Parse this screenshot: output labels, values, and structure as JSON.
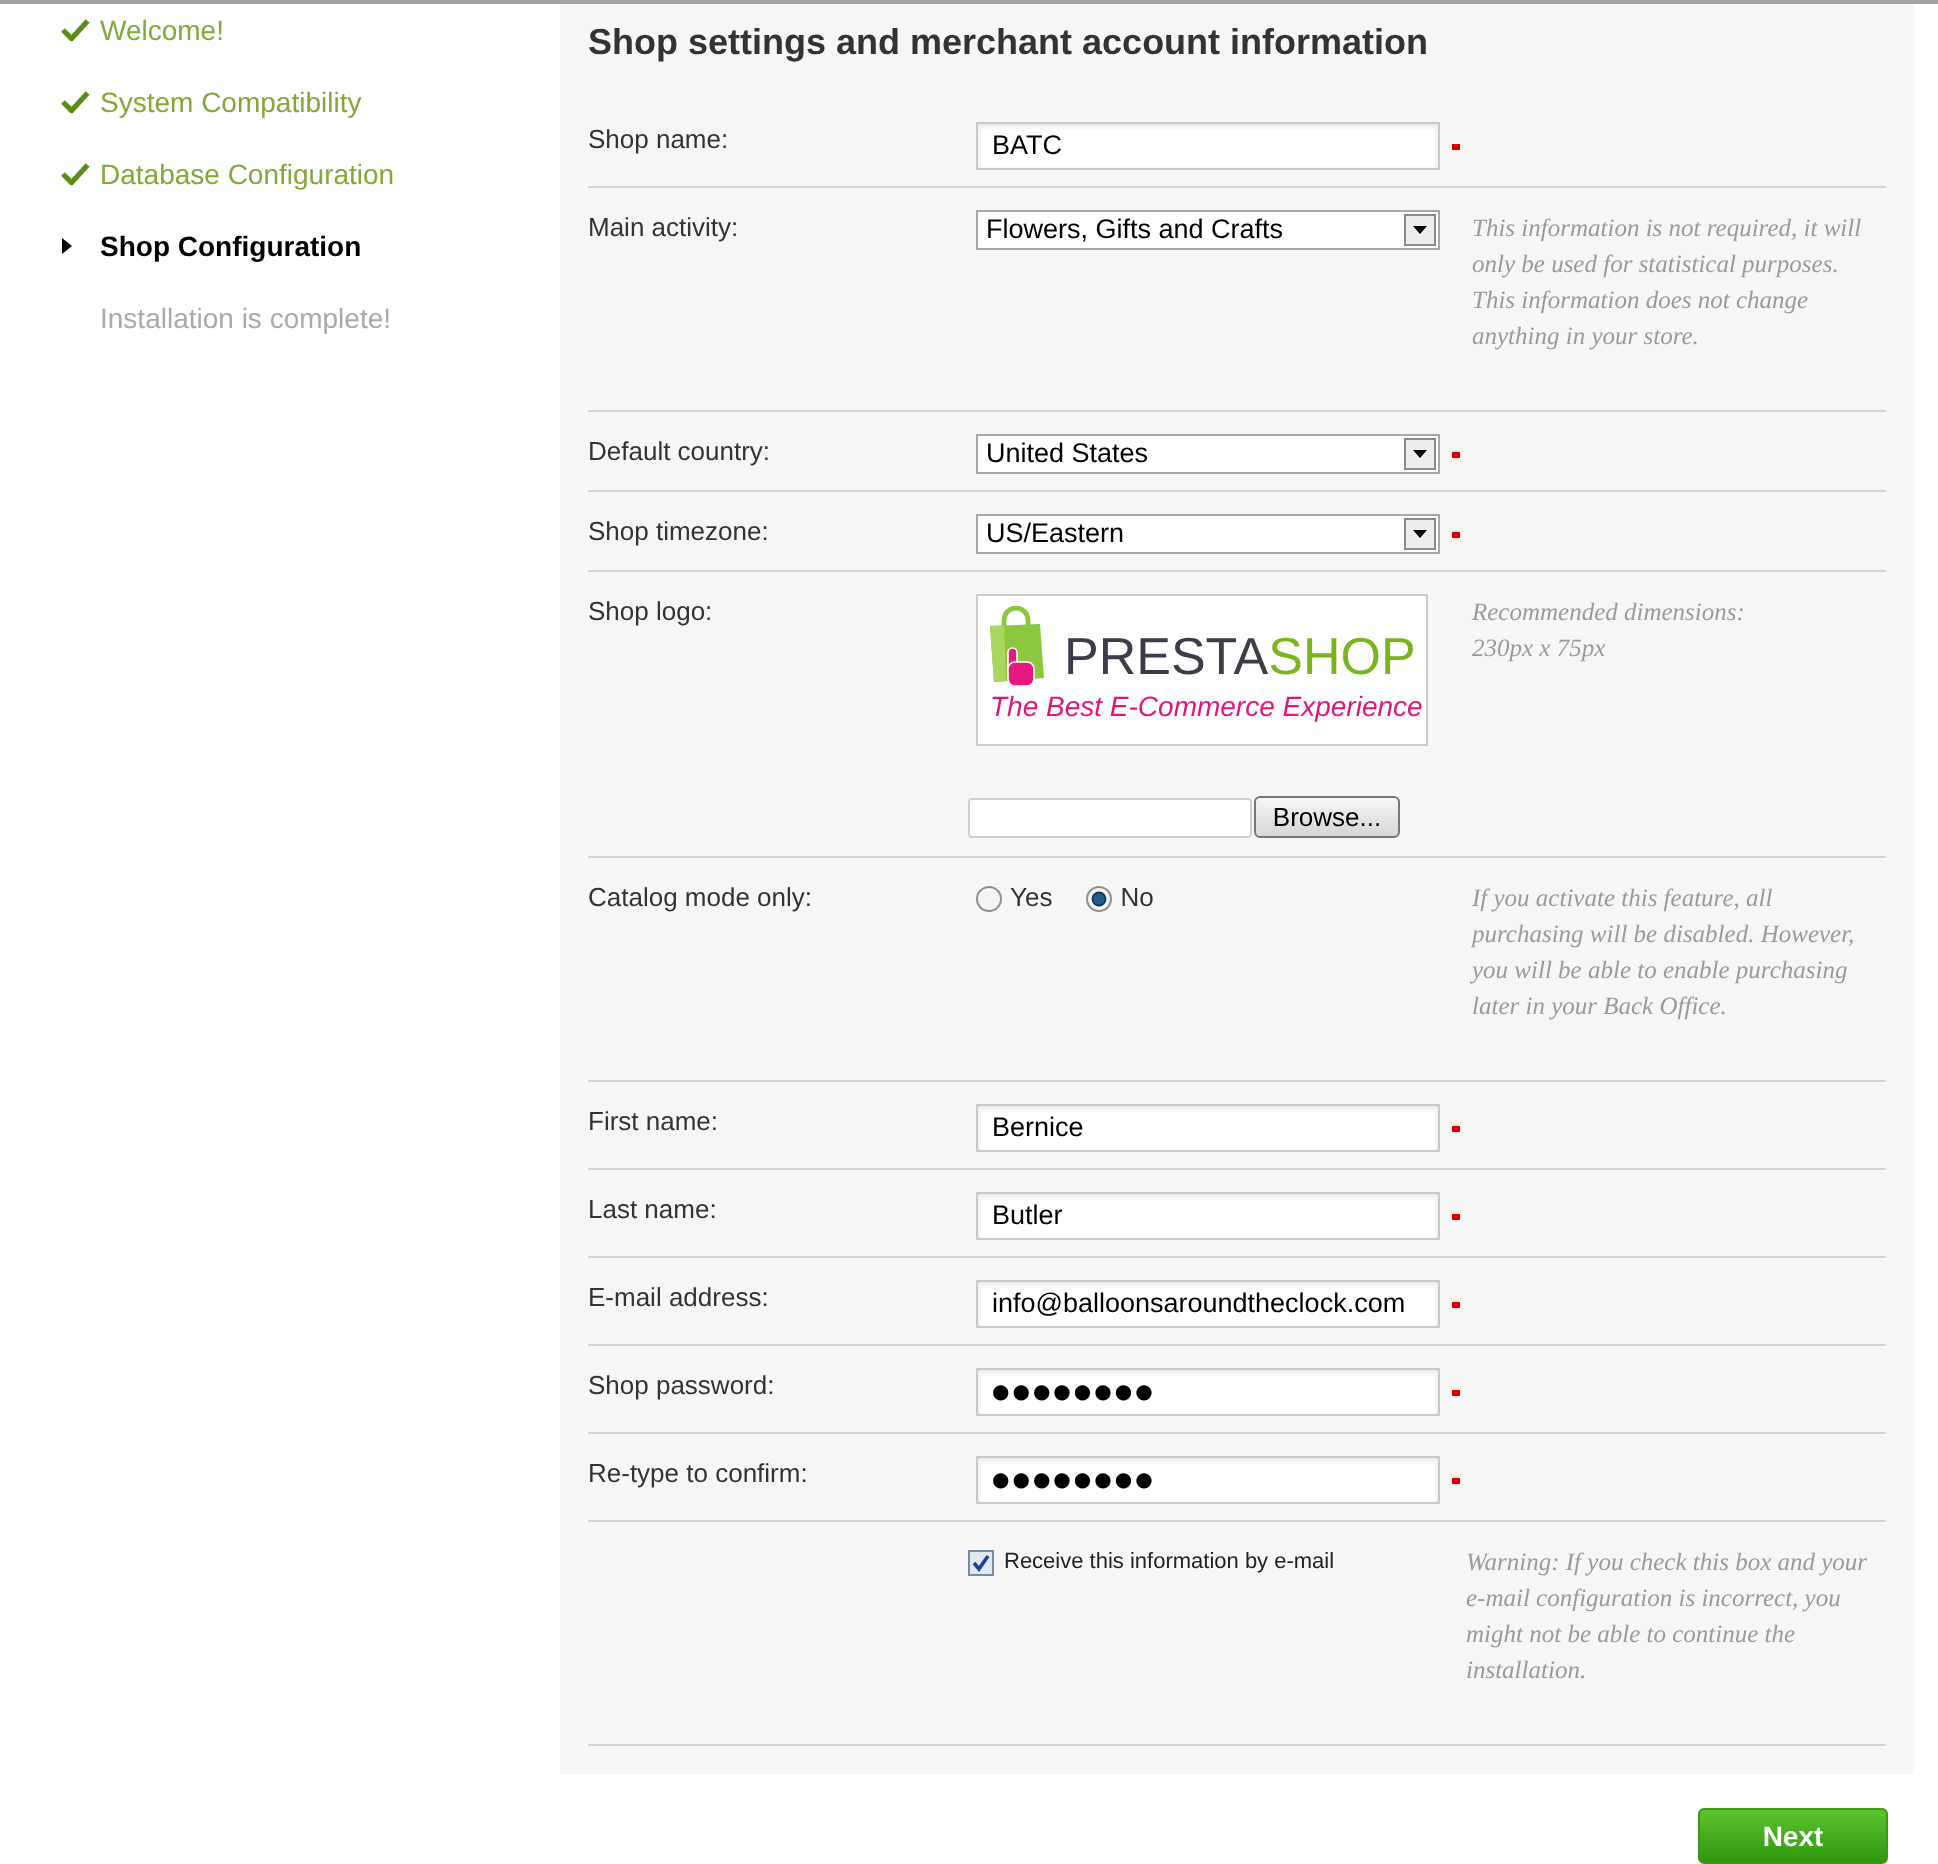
{
  "sidebar": {
    "steps": [
      {
        "label": "Welcome!",
        "kind": "done"
      },
      {
        "label": "System Compatibility",
        "kind": "done"
      },
      {
        "label": "Database Configuration",
        "kind": "done"
      },
      {
        "label": "Shop Configuration",
        "kind": "current"
      },
      {
        "label": "Installation is complete!",
        "kind": "pending"
      }
    ]
  },
  "form": {
    "title": "Shop settings and merchant account information",
    "rows": [
      {
        "kind": "text",
        "label": "Shop name:",
        "value": "BATC",
        "required": true
      },
      {
        "kind": "select",
        "label": "Main activity:",
        "value": "Flowers, Gifts and Crafts",
        "required": false,
        "note": "This information is not required, it will only be used for statistical purposes. This information does not change anything in your store."
      },
      {
        "kind": "select",
        "label": "Default country:",
        "value": "United States",
        "required": true
      },
      {
        "kind": "select",
        "label": "Shop timezone:",
        "value": "US/Eastern",
        "required": true
      },
      {
        "kind": "logo",
        "label": "Shop logo:",
        "logo": {
          "wordmark_dark": "PRESTA",
          "wordmark_green": "SHOP",
          "tagline": "The Best E-Commerce Experience"
        },
        "browse_button": "Browse...",
        "required": false,
        "note": "Recommended dimensions:\n230px x 75px"
      },
      {
        "kind": "radio",
        "label": "Catalog mode only:",
        "options": [
          {
            "label": "Yes",
            "selected": false
          },
          {
            "label": "No",
            "selected": true
          }
        ],
        "required": false,
        "note": "If you activate this feature, all purchasing will be disabled. However, you will be able to enable purchasing later in your Back Office."
      },
      {
        "kind": "text",
        "label": "First name:",
        "value": "Bernice",
        "required": true
      },
      {
        "kind": "text",
        "label": "Last name:",
        "value": "Butler",
        "required": true
      },
      {
        "kind": "text",
        "label": "E-mail address:",
        "value": "info@balloonsaroundtheclock.com",
        "required": true
      },
      {
        "kind": "password",
        "label": "Shop password:",
        "value": "●●●●●●●●",
        "required": true
      },
      {
        "kind": "password",
        "label": "Re-type to confirm:",
        "value": "●●●●●●●●",
        "required": true
      },
      {
        "kind": "checkbox",
        "label": "Receive this information by e-mail",
        "checked": true,
        "required": false,
        "note": "Warning: If you check this box and your e-mail configuration is incorrect, you might not be able to continue the installation."
      }
    ]
  },
  "next_button": "Next"
}
